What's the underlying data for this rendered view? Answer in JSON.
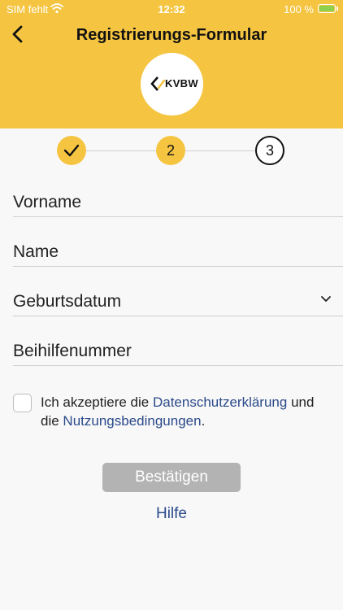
{
  "status_bar": {
    "carrier": "SIM fehlt",
    "time": "12:32",
    "battery": "100 %"
  },
  "header": {
    "title": "Registrierungs-Formular",
    "logo_text": "KVBW"
  },
  "stepper": {
    "steps": [
      {
        "label": "",
        "state": "done"
      },
      {
        "label": "2",
        "state": "current"
      },
      {
        "label": "3",
        "state": "pending"
      }
    ]
  },
  "form": {
    "fields": [
      {
        "label": "Vorname"
      },
      {
        "label": "Name"
      },
      {
        "label": "Geburtsdatum"
      },
      {
        "label": "Beihilfenummer"
      }
    ],
    "consent": {
      "prefix": "Ich akzeptiere die ",
      "privacy_link": "Datenschutzerklärung",
      "middle": " und die ",
      "terms_link": "Nutzungsbedingungen",
      "suffix": "."
    },
    "confirm_label": "Bestätigen",
    "help_label": "Hilfe"
  },
  "colors": {
    "accent": "#f5c542",
    "link": "#2b4a8a",
    "button_disabled": "#b3b3b3"
  }
}
